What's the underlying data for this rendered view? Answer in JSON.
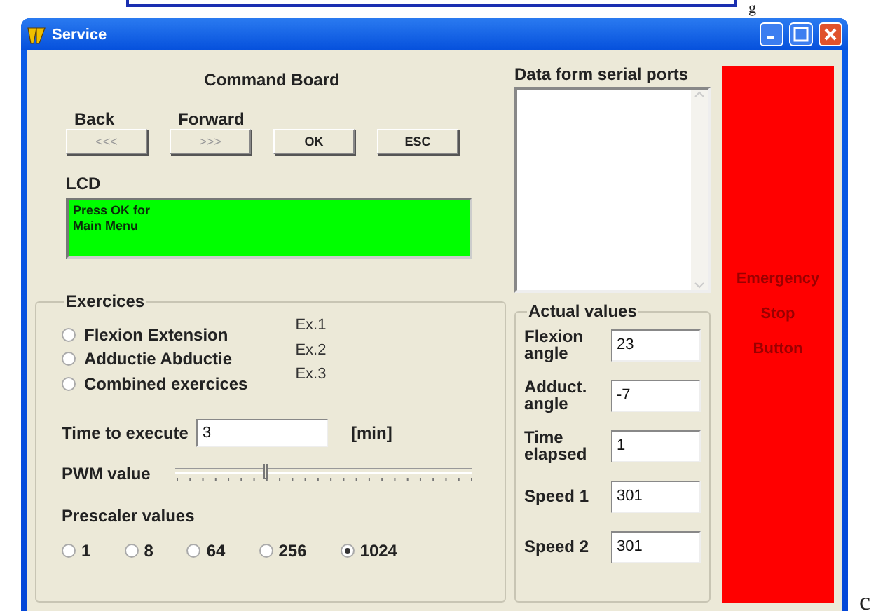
{
  "document": {
    "top_mark": "g",
    "side_mark": "c"
  },
  "window": {
    "title": "Service"
  },
  "command_board": {
    "title": "Command Board",
    "buttons": [
      {
        "caption": "Back",
        "label": "<<<"
      },
      {
        "caption": "Forward",
        "label": ">>>"
      },
      {
        "label": "OK"
      },
      {
        "label": "ESC"
      }
    ],
    "lcd_label": "LCD",
    "lcd_text": "Press OK for Main Menu"
  },
  "serial": {
    "label": "Data form serial ports"
  },
  "exercises": {
    "title": "Exercices",
    "options": [
      {
        "label": "Flexion Extension",
        "code": "Ex.1",
        "selected": false
      },
      {
        "label": "Adductie Abductie",
        "code": "Ex.2",
        "selected": false
      },
      {
        "label": "Combined exercices",
        "code": "Ex.3",
        "selected": false
      }
    ],
    "time": {
      "label": "Time to execute",
      "value": "3",
      "unit": "[min]"
    },
    "pwm": {
      "label": "PWM value",
      "level": 0.3
    },
    "prescaler": {
      "label": "Prescaler values",
      "options": [
        {
          "label": "1",
          "selected": false
        },
        {
          "label": "8",
          "selected": false
        },
        {
          "label": "64",
          "selected": false
        },
        {
          "label": "256",
          "selected": false
        },
        {
          "label": "1024",
          "selected": true
        }
      ]
    }
  },
  "actual_values": {
    "title": "Actual values",
    "fields": [
      {
        "label": "Flexion angle",
        "value": "23"
      },
      {
        "label": "Adduct. angle",
        "value": "-7"
      },
      {
        "label": "Time elapsed",
        "value": "1"
      },
      {
        "label": "Speed 1",
        "value": "301"
      },
      {
        "label": "Speed 2",
        "value": "301"
      }
    ]
  },
  "emergency_button": {
    "label": "Emergency Stop Button"
  }
}
